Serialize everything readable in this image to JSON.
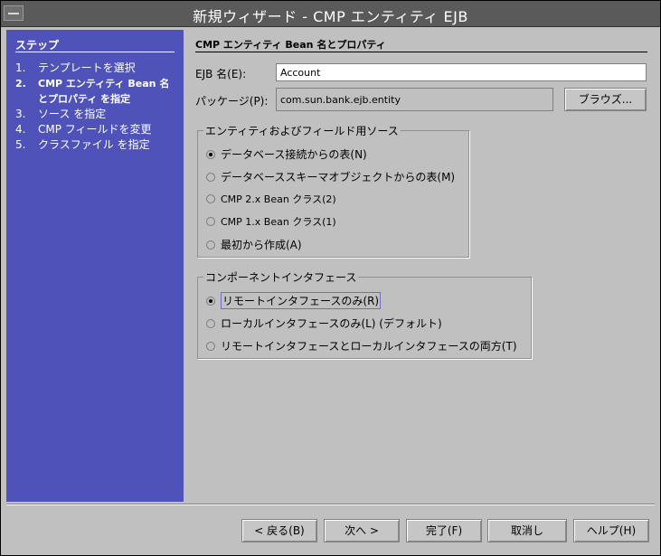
{
  "window": {
    "title": "新規ウィザード - CMP エンティティ EJB"
  },
  "steps": {
    "heading": "ステップ",
    "items": [
      {
        "num": "1.",
        "label": "テンプレートを選択"
      },
      {
        "num": "2.",
        "label": "CMP エンティティ Bean 名とプロパティ を指定"
      },
      {
        "num": "3.",
        "label": "ソース を指定"
      },
      {
        "num": "4.",
        "label": "CMP フィールドを変更"
      },
      {
        "num": "5.",
        "label": "クラスファイル を指定"
      }
    ]
  },
  "main": {
    "section_title": "CMP エンティティ Bean 名とプロパティ",
    "ejb_name_label": "EJB 名(E):",
    "ejb_name_value": "Account",
    "package_label": "パッケージ(P):",
    "package_value": "com.sun.bank.ejb.entity",
    "browse_label": "ブラウズ...",
    "source_group": {
      "legend": "エンティティおよびフィールド用ソース",
      "options": [
        "データベース接続からの表(N)",
        "データベーススキーマオブジェクトからの表(M)",
        "CMP 2.x Bean クラス(2)",
        "CMP 1.x Bean クラス(1)",
        "最初から作成(A)"
      ],
      "selected": 0
    },
    "interface_group": {
      "legend": "コンポーネントインタフェース",
      "options": [
        "リモートインタフェースのみ(R)",
        "ローカルインタフェースのみ(L) (デフォルト)",
        "リモートインタフェースとローカルインタフェースの両方(T)"
      ],
      "selected": 0
    }
  },
  "buttons": {
    "back": "< 戻る(B)",
    "next": "次へ >",
    "finish": "完了(F)",
    "cancel": "取消し",
    "help": "ヘルプ(H)"
  },
  "colors": {
    "sidebar": "#4f52b8",
    "titlebar": "#5a5a5a",
    "window": "#c0c0c0"
  }
}
